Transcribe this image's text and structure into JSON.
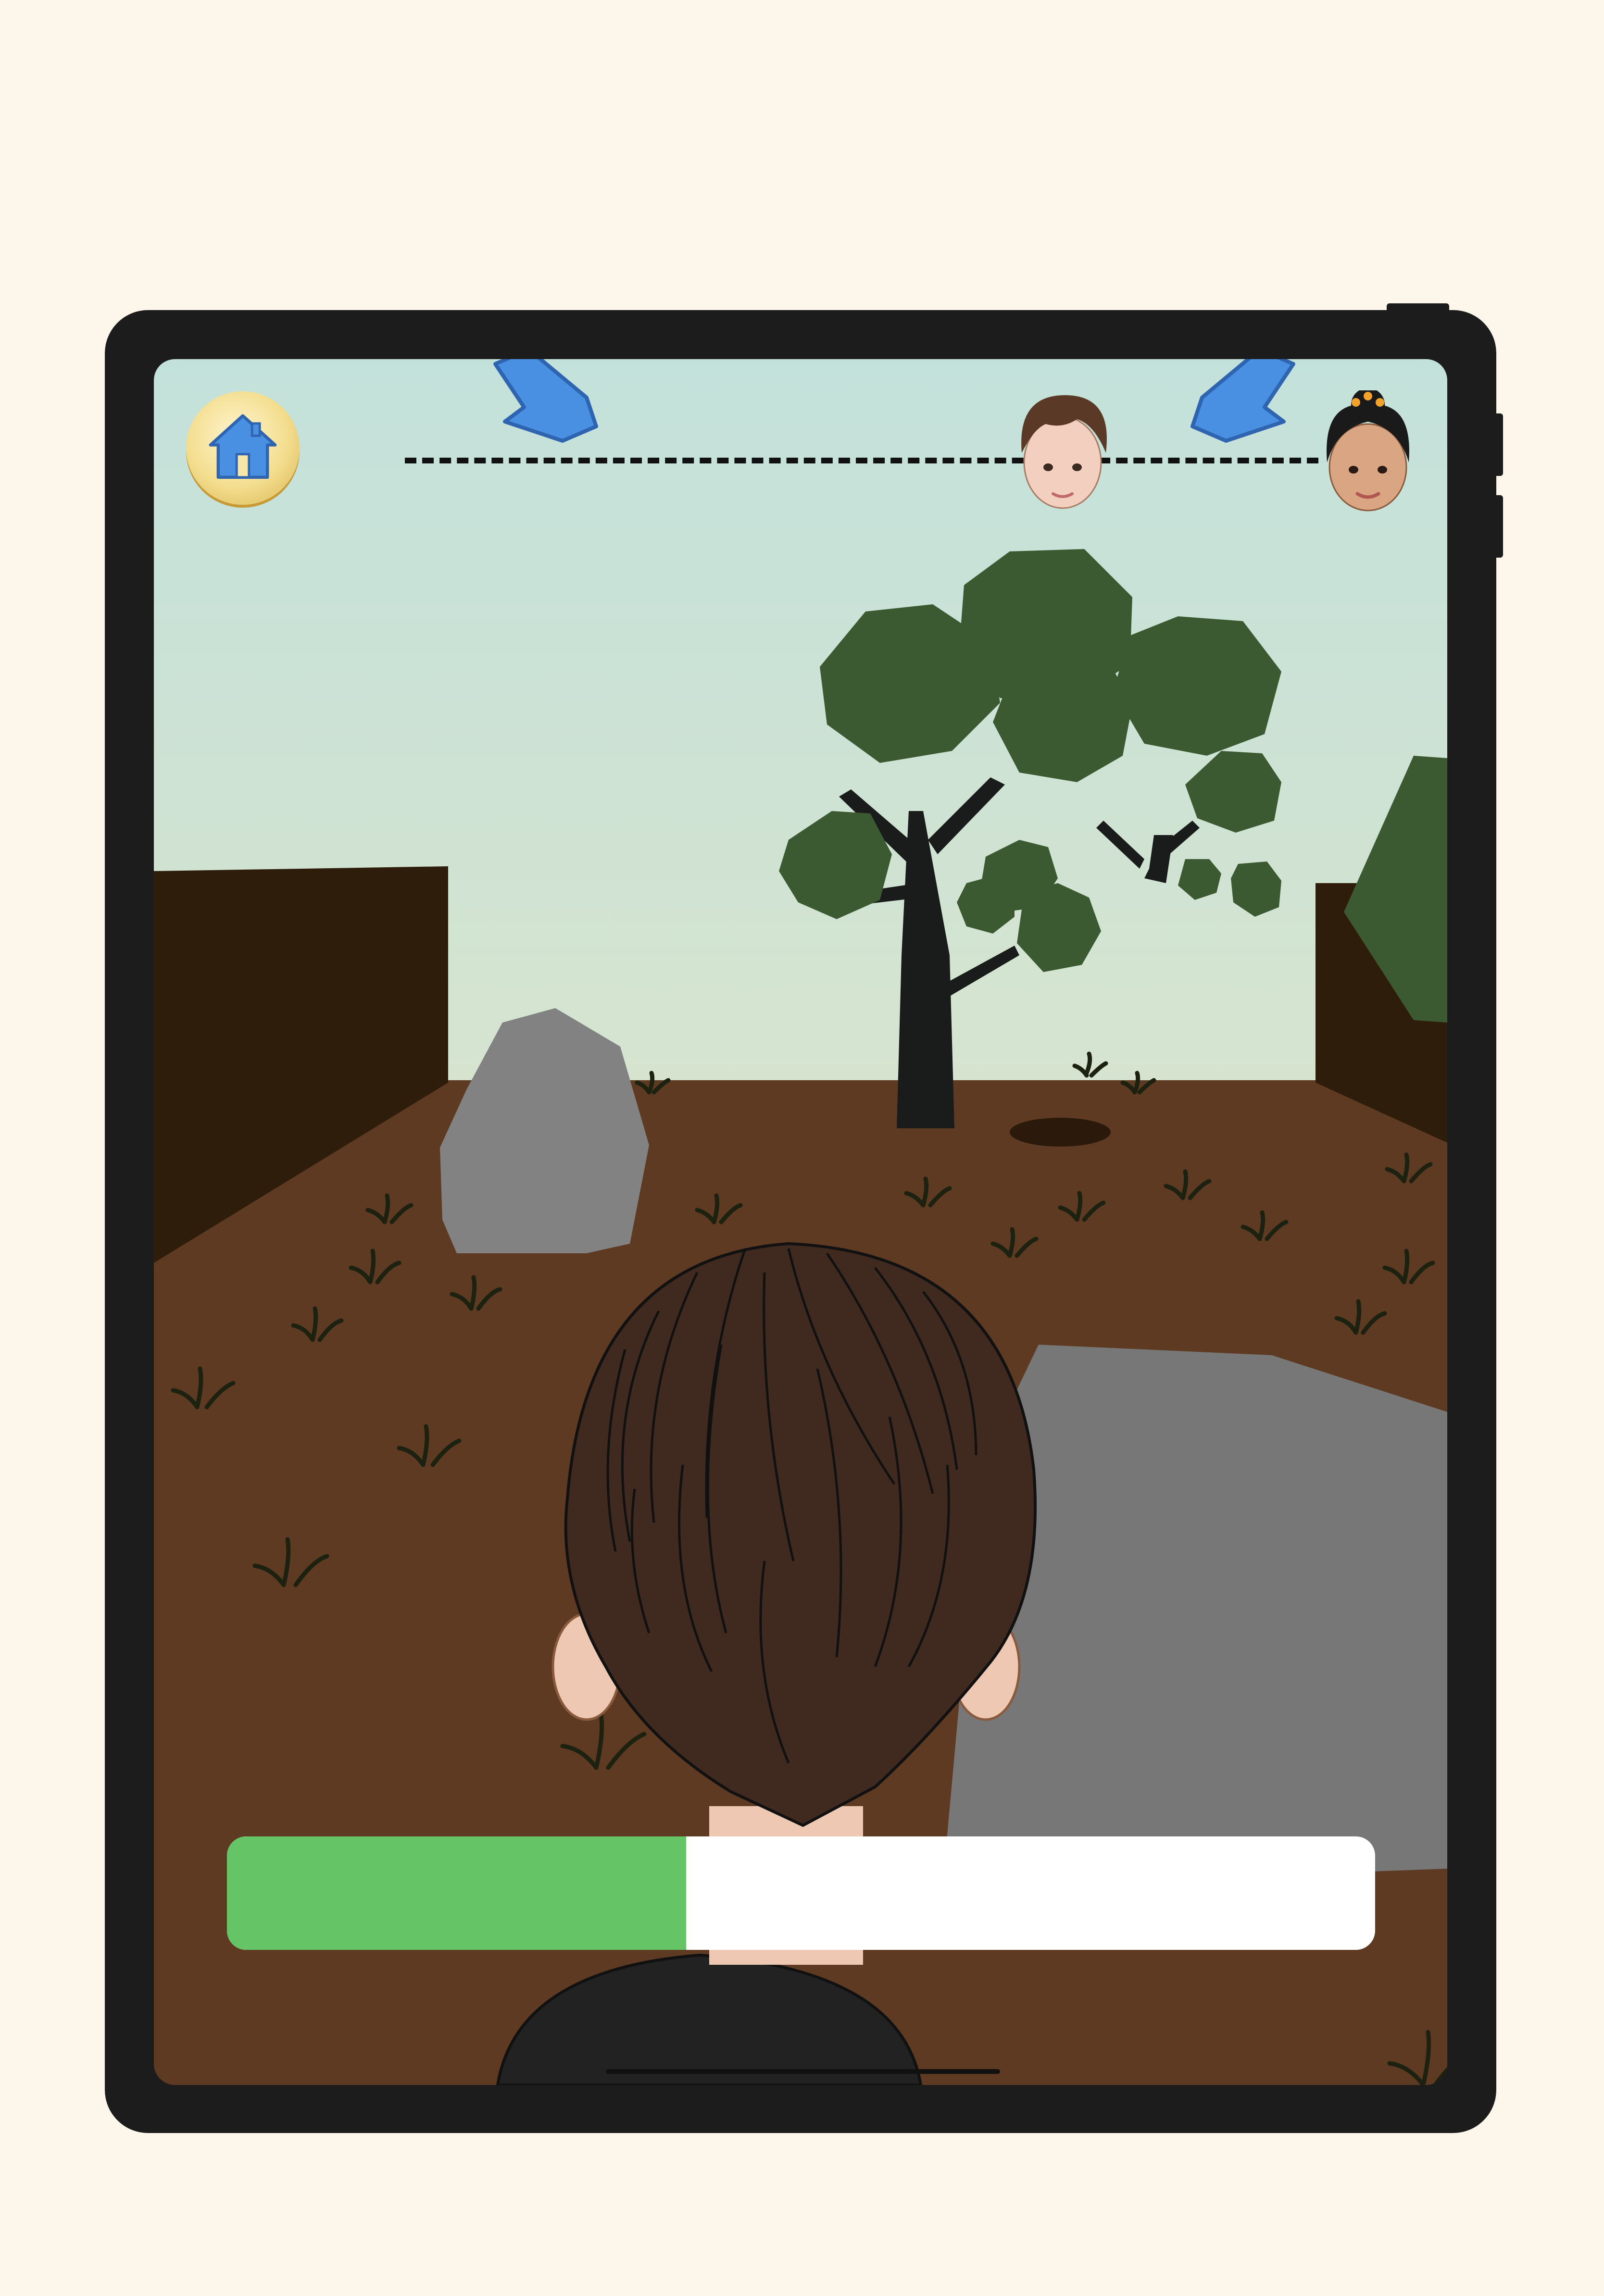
{
  "game": {
    "progress_fraction": 0.4,
    "progress_color": "#65c466",
    "sky_color": "#c8e3dc",
    "ground_color": "#5e3a22"
  },
  "hud": {
    "home_icon": "home-icon",
    "race_track": {
      "player_marker": "boy-avatar-icon",
      "goal_marker": "girl-avatar-icon",
      "arrows": [
        "arrow-down-left-icon",
        "arrow-down-left-icon"
      ]
    }
  },
  "colors": {
    "accent_blue": "#4a90e2",
    "home_button_gold": "#f3dd8e",
    "tablet_frame": "#1c1c1c"
  }
}
